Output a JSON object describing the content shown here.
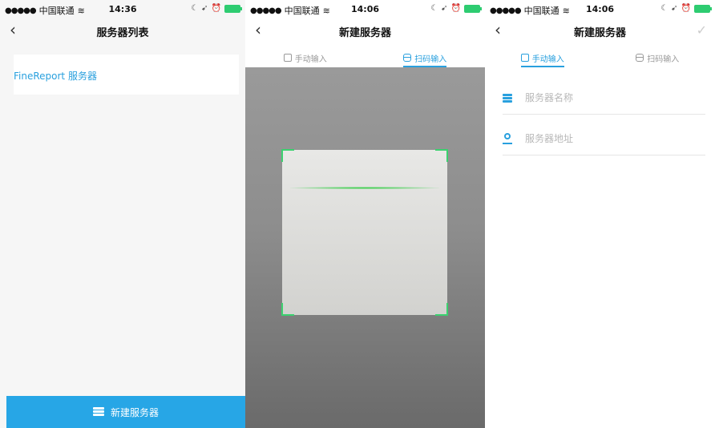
{
  "status_bars": [
    {
      "carrier": "中国联通",
      "time": "14:36"
    },
    {
      "carrier": "中国联通",
      "time": "14:06"
    },
    {
      "carrier": "中国联通",
      "time": "14:06"
    }
  ],
  "screen1": {
    "title": "服务器列表",
    "server_item": "FineReport 服务器",
    "add_button": "新建服务器"
  },
  "screen2": {
    "title": "新建服务器",
    "tab_manual": "手动输入",
    "tab_scan": "扫码输入",
    "active_tab": "scan"
  },
  "screen3": {
    "title": "新建服务器",
    "tab_manual": "手动输入",
    "tab_scan": "扫码输入",
    "active_tab": "manual",
    "name_placeholder": "服务器名称",
    "address_placeholder": "服务器地址"
  },
  "colors": {
    "accent": "#29a0de",
    "button_bg": "#27a6e6",
    "scan_green": "#3bd16f"
  },
  "icons": [
    "wifi-icon",
    "battery-icon",
    "back-chevron-icon",
    "server-icon",
    "edit-icon",
    "scan-icon",
    "location-icon",
    "check-icon"
  ]
}
